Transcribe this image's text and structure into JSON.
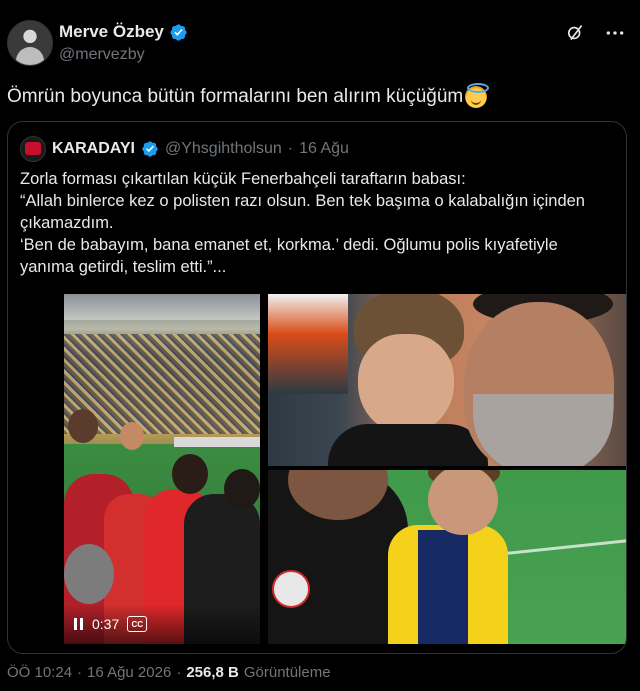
{
  "author": {
    "name": "Merve Özbey",
    "handle": "@mervezby"
  },
  "tweet": {
    "text": "Ömrün boyunca bütün formalarını ben alırım küçüğüm",
    "emoji": "smiling-face-with-halo"
  },
  "quoted": {
    "name": "KARADAYI",
    "handle": "@Yhsgihtholsun",
    "separator": "·",
    "date": "16 Ağu",
    "lines": [
      "Zorla forması çıkartılan küçük Fenerbahçeli taraftarın babası:",
      "“Allah binlerce kez o polisten razı olsun. Ben tek başıma o kalabalığın içinden",
      "çıkamazdım.",
      "‘Ben de babayım, bana emanet et, korkma.’ dedi. Oğlumu polis kıyafetiyle",
      "yanıma getirdi, teslim etti.”..."
    ],
    "video": {
      "time": "0:37",
      "cc_label": "CC"
    }
  },
  "footer": {
    "time": "ÖÖ 10:24",
    "separator": "·",
    "date": "16 Ağu 2026",
    "separator2": "·",
    "views_count": "256,8 B",
    "views_label": "Görüntüleme"
  },
  "colors": {
    "background": "#000000",
    "text": "#e7e9ea",
    "muted": "#71767b",
    "verified": "#1d9bf0",
    "border": "#2f3336"
  }
}
